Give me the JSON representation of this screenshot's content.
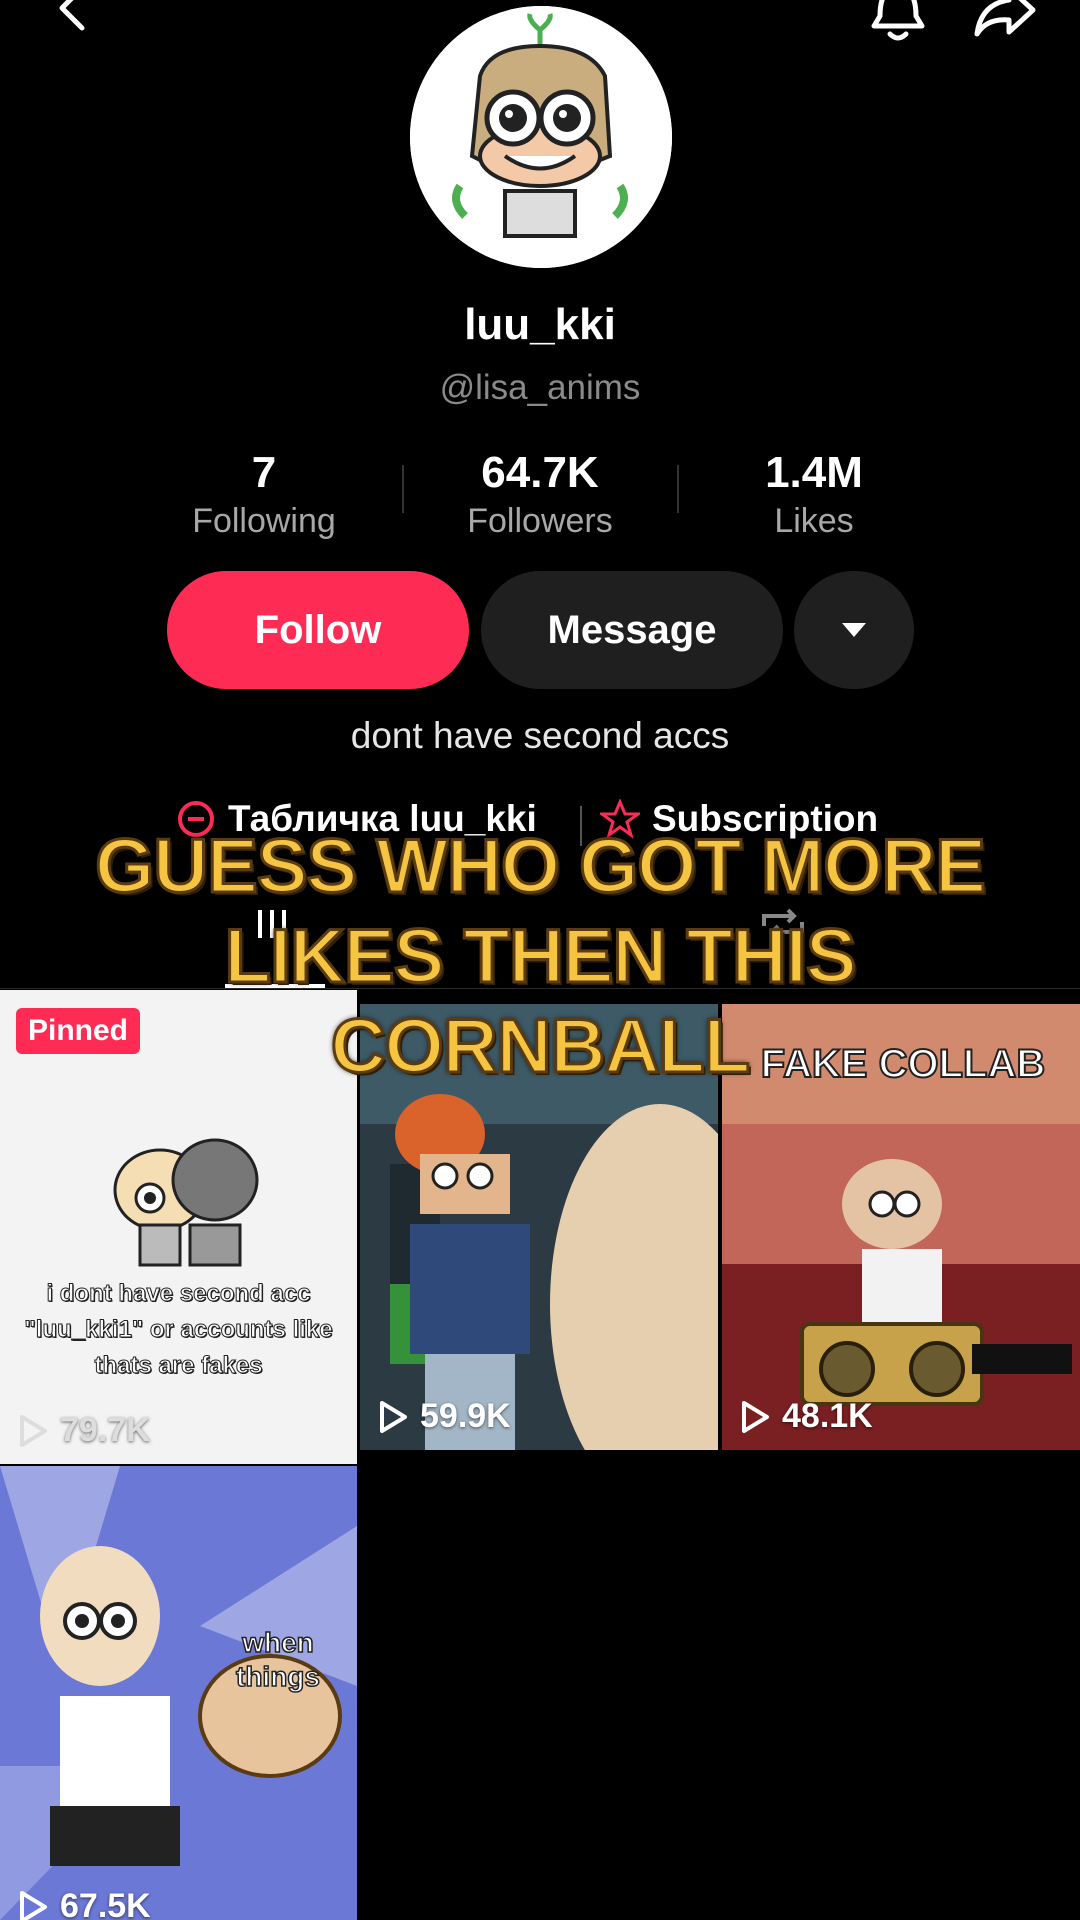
{
  "profile": {
    "display_name": "luu_kki",
    "username": "@lisa_anims",
    "bio": "dont have second accs"
  },
  "stats": [
    {
      "value": "7",
      "label": "Following"
    },
    {
      "value": "64.7K",
      "label": "Followers"
    },
    {
      "value": "1.4M",
      "label": "Likes"
    }
  ],
  "actions": {
    "follow": "Follow",
    "message": "Message"
  },
  "links": {
    "link1": "Табличка luu_kki",
    "link2": "Subscription"
  },
  "overlay_caption": "GUESS WHO GOT MORE LIKES THEN THIS CORNBALL",
  "videos": [
    {
      "views": "79.7K",
      "pinned": "Pinned",
      "caption": "i dont have second acc \"luu_kki1\" or accounts like thats are fakes"
    },
    {
      "views": "59.9K"
    },
    {
      "views": "48.1K",
      "caption": "FAKE COLLAB"
    },
    {
      "views": "67.5K",
      "caption": "when things"
    }
  ],
  "colors": {
    "background": "#000000",
    "follow": "#fe2c55",
    "secondary_button": "#1f1f1f",
    "overlay_text": "#f5c542"
  }
}
